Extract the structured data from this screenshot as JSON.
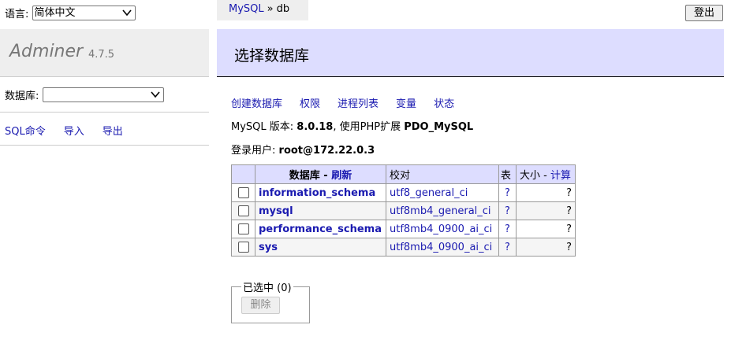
{
  "language": {
    "label": "语言:",
    "selected": "简体中文"
  },
  "logo": {
    "name": "Adminer",
    "version": "4.7.5"
  },
  "database_select": {
    "label": "数据库:",
    "selected": ""
  },
  "sidebar": {
    "links": [
      "SQL命令",
      "导入",
      "导出"
    ]
  },
  "breadcrumb": {
    "server": "MySQL",
    "separator": "»",
    "db": "db"
  },
  "logout_label": "登出",
  "page_title": "选择数据库",
  "top_links": [
    "创建数据库",
    "权限",
    "进程列表",
    "变量",
    "状态"
  ],
  "version_info": {
    "prefix": "MySQL 版本:",
    "version": "8.0.18",
    "ext_prefix": ", 使用PHP扩展",
    "extension": "PDO_MySQL"
  },
  "login_info": {
    "prefix": "登录用户:",
    "user": "root@172.22.0.3"
  },
  "table": {
    "headers": {
      "database": "数据库",
      "dash": " - ",
      "refresh": "刷新",
      "collation": "校对",
      "tables": "表",
      "size": "大小",
      "compute": "计算"
    },
    "rows": [
      {
        "name": "information_schema",
        "collation": "utf8_general_ci",
        "tables": "?",
        "size": "?"
      },
      {
        "name": "mysql",
        "collation": "utf8mb4_general_ci",
        "tables": "?",
        "size": "?"
      },
      {
        "name": "performance_schema",
        "collation": "utf8mb4_0900_ai_ci",
        "tables": "?",
        "size": "?"
      },
      {
        "name": "sys",
        "collation": "utf8mb4_0900_ai_ci",
        "tables": "?",
        "size": "?"
      }
    ]
  },
  "selected_box": {
    "legend": "已选中 (0)",
    "delete_label": "删除"
  },
  "colors": {
    "accent_link": "#1a1ab0",
    "title_bg": "#ddf",
    "panel_bg": "#eee"
  }
}
